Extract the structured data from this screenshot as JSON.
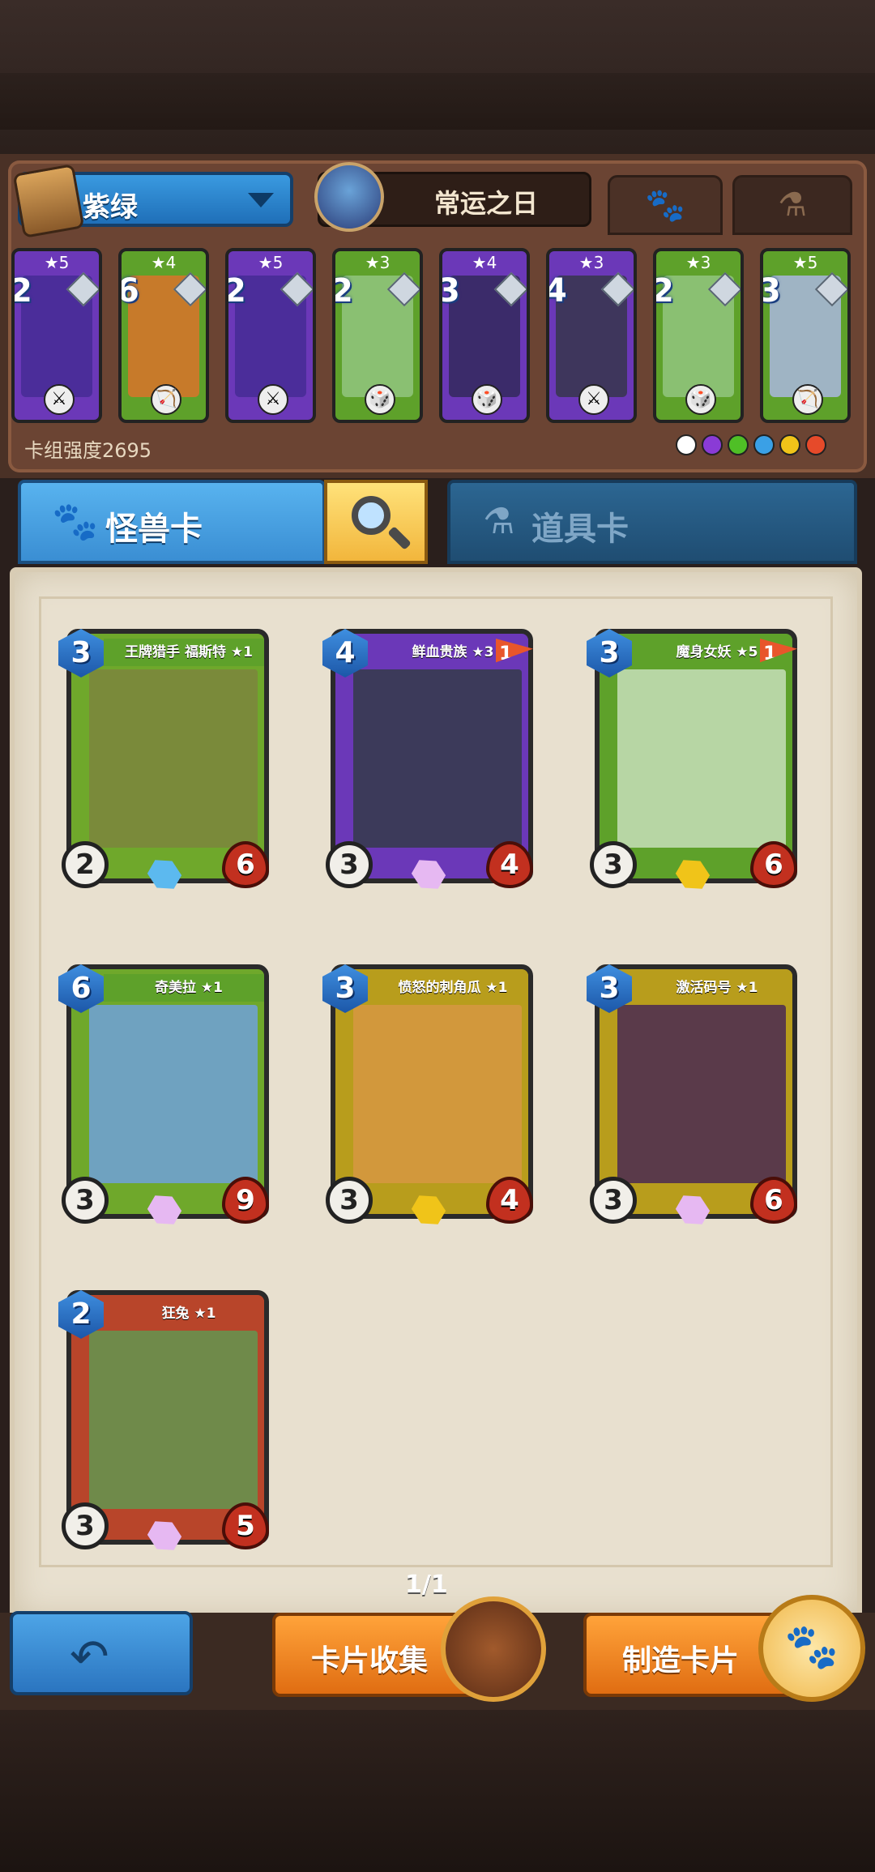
{
  "deck": {
    "name": "紫绿",
    "hero_name": "常运之日",
    "strength_label": "卡组强度2695",
    "mini_cards": [
      {
        "stars": "★5",
        "cost": "2",
        "color": "#6b38b8",
        "art": "#4b2d9a",
        "icon": "⚔"
      },
      {
        "stars": "★4",
        "cost": "6",
        "color": "#5ea12a",
        "art": "#c77a2a",
        "icon": "🏹"
      },
      {
        "stars": "★5",
        "cost": "2",
        "color": "#6b38b8",
        "art": "#4b2d9a",
        "icon": "⚔"
      },
      {
        "stars": "★3",
        "cost": "2",
        "color": "#5ea12a",
        "art": "#8ac072",
        "icon": "🎲"
      },
      {
        "stars": "★4",
        "cost": "3",
        "color": "#6b38b8",
        "art": "#3b2b6a",
        "icon": "🎲"
      },
      {
        "stars": "★3",
        "cost": "4",
        "color": "#6b38b8",
        "art": "#3e365c",
        "icon": "⚔"
      },
      {
        "stars": "★3",
        "cost": "2",
        "color": "#5ea12a",
        "art": "#8ac072",
        "icon": "🎲"
      },
      {
        "stars": "★5",
        "cost": "3",
        "color": "#5ea12a",
        "art": "#9fb4c4",
        "icon": "🏹"
      }
    ],
    "element_colors": [
      "#ffffff",
      "#8a3bd6",
      "#4fbf26",
      "#3aa0e6",
      "#f0c419",
      "#e64a2a"
    ]
  },
  "tabs": {
    "monster_label": "怪兽卡",
    "item_label": "道具卡"
  },
  "cards": [
    {
      "name": "王牌猎手 福斯特 ★1",
      "cost": "3",
      "atk": "2",
      "hp": "6",
      "frame": "#6fa82b",
      "banner": "#5ea12a",
      "art": "#7a8a3a",
      "rarity": "#5cb9ef",
      "flag": ""
    },
    {
      "name": "鲜血贵族 ★3",
      "cost": "4",
      "atk": "3",
      "hp": "4",
      "frame": "#6b38b8",
      "banner": "#6b38b8",
      "art": "#3c3a5a",
      "rarity": "#e6b8f2",
      "flag": "1"
    },
    {
      "name": "魔身女妖 ★5",
      "cost": "3",
      "atk": "3",
      "hp": "6",
      "frame": "#5ea12a",
      "banner": "#5ea12a",
      "art": "#b7d6a4",
      "rarity": "#f0c419",
      "flag": "1"
    },
    {
      "name": "奇美拉 ★1",
      "cost": "6",
      "atk": "3",
      "hp": "9",
      "frame": "#6fa82b",
      "banner": "#5ea12a",
      "art": "#6fa2c0",
      "rarity": "#e6b8f2",
      "flag": ""
    },
    {
      "name": "愤怒的刺角瓜 ★1",
      "cost": "3",
      "atk": "3",
      "hp": "4",
      "frame": "#b89d1c",
      "banner": "#b89d1c",
      "art": "#d2983c",
      "rarity": "#f0c419",
      "flag": ""
    },
    {
      "name": "激活码号 ★1",
      "cost": "3",
      "atk": "3",
      "hp": "6",
      "frame": "#b89d1c",
      "banner": "#b89d1c",
      "art": "#5a3a4a",
      "rarity": "#e6b8f2",
      "flag": ""
    },
    {
      "name": "狂兔 ★1",
      "cost": "2",
      "atk": "3",
      "hp": "5",
      "frame": "#b8452a",
      "banner": "#b8452a",
      "art": "#6f8a4a",
      "rarity": "#e6b8f2",
      "flag": ""
    }
  ],
  "pagination": {
    "page_label": "1/1"
  },
  "buttons": {
    "collect_label": "卡片收集",
    "craft_label": "制造卡片"
  }
}
